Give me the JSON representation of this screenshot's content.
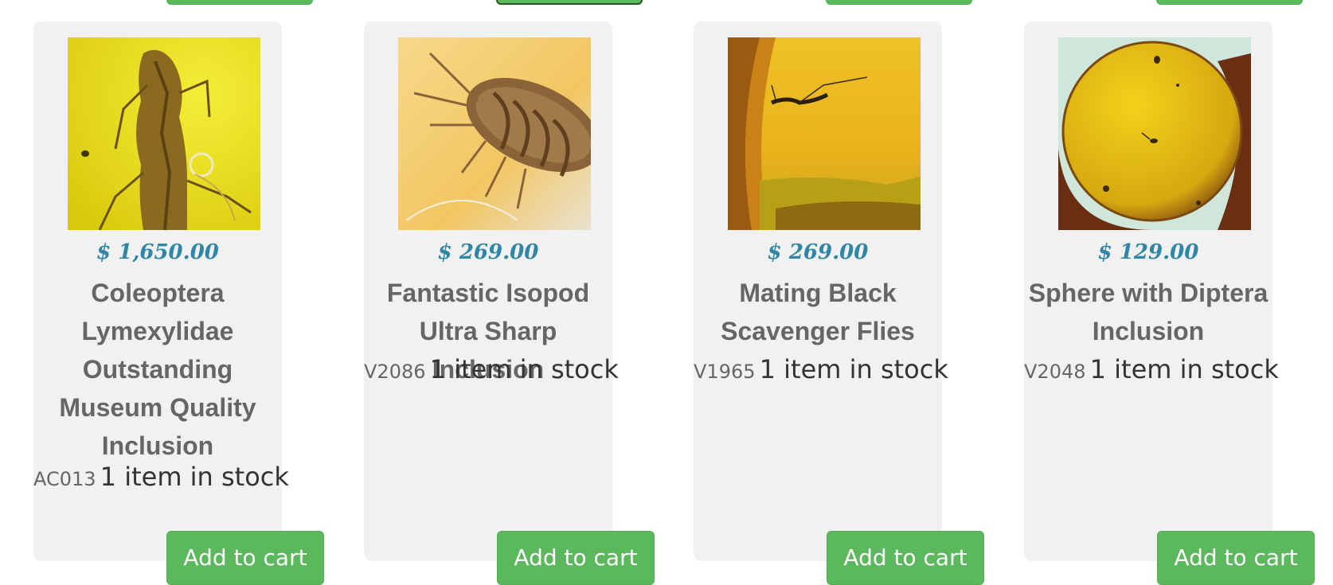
{
  "colors": {
    "card_bg": "#f1f1f1",
    "price": "#2f86a6",
    "title": "#666666",
    "button": "#5cb85c"
  },
  "products": [
    {
      "image_icon": "amber-beetle-photo",
      "price": "$ 1,650.00",
      "title": "Coleoptera Lymexylidae Outstanding Museum Quality Inclusion",
      "sku": "AC013",
      "stock": "1 item in stock",
      "button_label": "Add to cart"
    },
    {
      "image_icon": "amber-isopod-photo",
      "price": "$ 269.00",
      "title": "Fantastic Isopod Ultra Sharp Inclusion",
      "sku": "V2086",
      "stock": "1 item in stock",
      "button_label": "Add to cart"
    },
    {
      "image_icon": "amber-flies-photo",
      "price": "$ 269.00",
      "title": "Mating Black Scavenger Flies",
      "sku": "V1965",
      "stock": "1 item in stock",
      "button_label": "Add to cart"
    },
    {
      "image_icon": "amber-sphere-photo",
      "price": "$ 129.00",
      "title": "Sphere with Diptera Inclusion",
      "sku": "V2048",
      "stock": "1 item in stock",
      "button_label": "Add to cart"
    }
  ]
}
